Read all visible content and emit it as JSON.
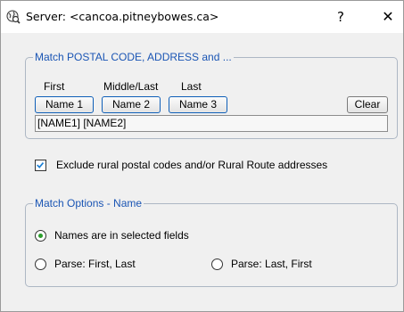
{
  "titlebar": {
    "title": "Server: <cancoa.pitneybowes.ca>",
    "help_label": "?",
    "close_label": "✕"
  },
  "match_group": {
    "legend": "Match POSTAL CODE, ADDRESS and ...",
    "columns": [
      "First",
      "Middle/Last",
      "Last"
    ],
    "buttons": [
      "Name 1",
      "Name 2",
      "Name 3"
    ],
    "clear_label": "Clear",
    "field_value": "[NAME1] [NAME2]"
  },
  "exclude": {
    "checked": true,
    "label": "Exclude rural postal codes and/or Rural Route addresses"
  },
  "options_group": {
    "legend": "Match Options - Name",
    "options": [
      {
        "label": "Names are in selected fields",
        "selected": true
      },
      {
        "label": "Parse: First, Last",
        "selected": false
      },
      {
        "label": "Parse: Last, First",
        "selected": false
      }
    ]
  },
  "colors": {
    "legend": "#1a55b4",
    "group_border": "#adb7c4",
    "button_border": "#0f5fb8",
    "check": "#1a7fd6",
    "radio_dot": "#2c9d2c"
  },
  "icons": {
    "app": "globe-magnifier-icon",
    "check": "checkmark-icon"
  }
}
